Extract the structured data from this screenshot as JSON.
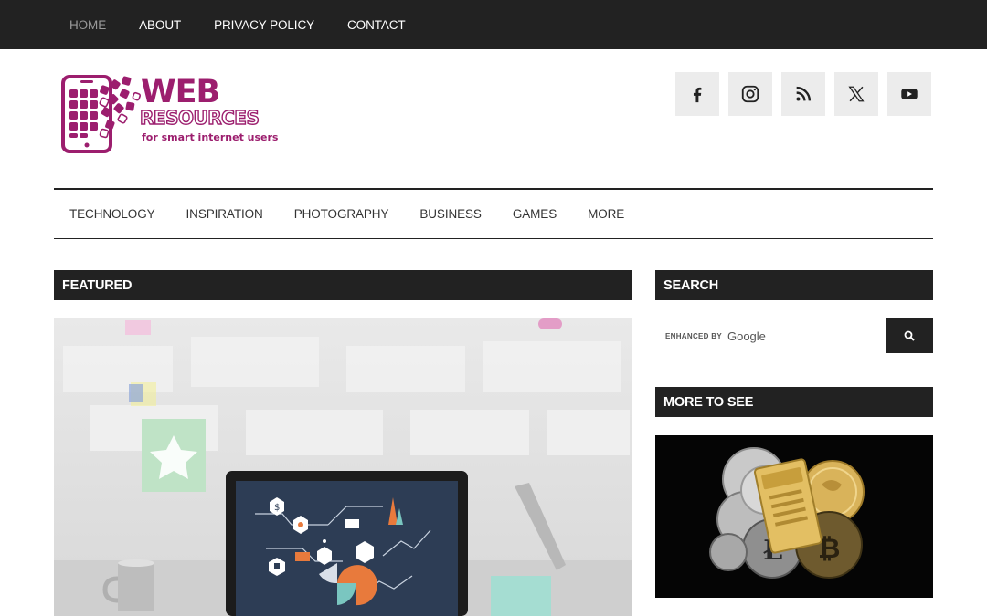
{
  "topnav": {
    "items": [
      {
        "label": "HOME",
        "active": true
      },
      {
        "label": "ABOUT"
      },
      {
        "label": "PRIVACY POLICY"
      },
      {
        "label": "CONTACT"
      }
    ]
  },
  "logo": {
    "line1": "WEB",
    "line2": "RESOURCES",
    "tagline": "for smart internet users",
    "color": "#9c1e6e"
  },
  "social": {
    "icons": [
      "facebook-icon",
      "instagram-icon",
      "rss-icon",
      "x-twitter-icon",
      "youtube-icon"
    ]
  },
  "mainnav": {
    "items": [
      "TECHNOLOGY",
      "INSPIRATION",
      "PHOTOGRAPHY",
      "BUSINESS",
      "GAMES",
      "MORE"
    ]
  },
  "featured": {
    "heading": "FEATURED"
  },
  "sidebar": {
    "search_heading": "SEARCH",
    "search_enhanced_by": "ENHANCED BY",
    "search_brand": "Google",
    "search_value": "",
    "more_heading": "MORE TO SEE"
  },
  "colors": {
    "dark": "#222222",
    "brand": "#9c1e6e",
    "social_bg": "#ececec"
  }
}
